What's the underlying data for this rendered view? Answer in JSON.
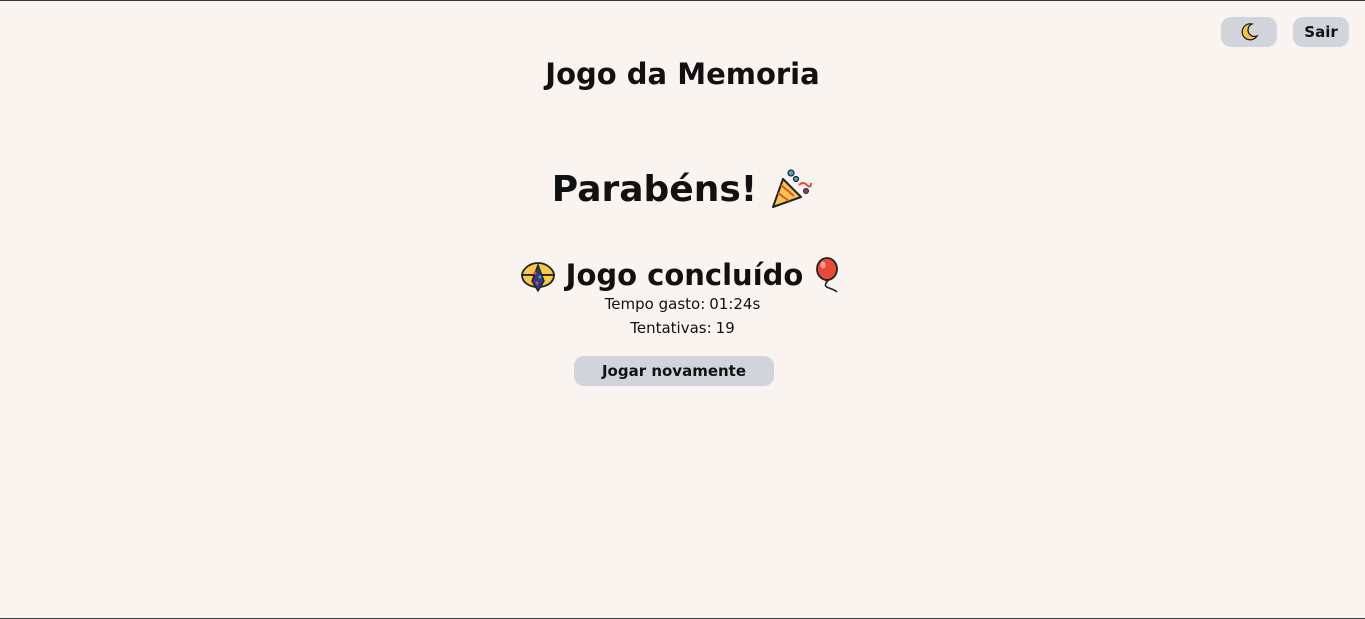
{
  "header": {
    "theme_toggle_icon": "moon-icon",
    "logout_label": "Sair"
  },
  "app_title": "Jogo da Memoria",
  "result": {
    "congrats_text": "Parabéns!",
    "congrats_icon": "party-popper-icon",
    "status_text": "Jogo concluído",
    "status_left_icon": "confetti-ball-icon",
    "status_right_icon": "balloon-icon",
    "time_label": "Tempo gasto:",
    "time_value": "01:24s",
    "attempts_label": "Tentativas:",
    "attempts_value": "19",
    "replay_label": "Jogar novamente"
  },
  "colors": {
    "background": "#f9f4f0",
    "button_bg": "#d1d5db",
    "text": "#111111"
  }
}
